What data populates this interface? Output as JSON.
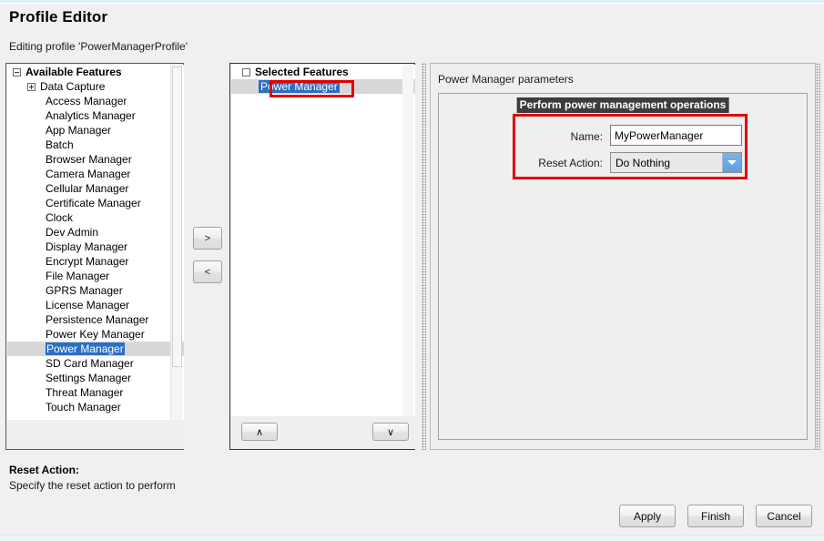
{
  "window": {
    "title": "Profile Editor",
    "subtitle": "Editing profile 'PowerManagerProfile'"
  },
  "available_panel": {
    "root_label": "Available Features",
    "items": [
      {
        "label": "Data Capture",
        "level": 1,
        "expander": "plus",
        "selected": false
      },
      {
        "label": "Access Manager",
        "level": 2,
        "expander": "none",
        "selected": false
      },
      {
        "label": "Analytics Manager",
        "level": 2,
        "expander": "none",
        "selected": false
      },
      {
        "label": "App Manager",
        "level": 2,
        "expander": "none",
        "selected": false
      },
      {
        "label": "Batch",
        "level": 2,
        "expander": "none",
        "selected": false
      },
      {
        "label": "Browser Manager",
        "level": 2,
        "expander": "none",
        "selected": false
      },
      {
        "label": "Camera Manager",
        "level": 2,
        "expander": "none",
        "selected": false
      },
      {
        "label": "Cellular Manager",
        "level": 2,
        "expander": "none",
        "selected": false
      },
      {
        "label": "Certificate Manager",
        "level": 2,
        "expander": "none",
        "selected": false
      },
      {
        "label": "Clock",
        "level": 2,
        "expander": "none",
        "selected": false
      },
      {
        "label": "Dev Admin",
        "level": 2,
        "expander": "none",
        "selected": false
      },
      {
        "label": "Display Manager",
        "level": 2,
        "expander": "none",
        "selected": false
      },
      {
        "label": "Encrypt Manager",
        "level": 2,
        "expander": "none",
        "selected": false
      },
      {
        "label": "File Manager",
        "level": 2,
        "expander": "none",
        "selected": false
      },
      {
        "label": "GPRS Manager",
        "level": 2,
        "expander": "none",
        "selected": false
      },
      {
        "label": "License Manager",
        "level": 2,
        "expander": "none",
        "selected": false
      },
      {
        "label": "Persistence Manager",
        "level": 2,
        "expander": "none",
        "selected": false
      },
      {
        "label": "Power Key Manager",
        "level": 2,
        "expander": "none",
        "selected": false
      },
      {
        "label": "Power Manager",
        "level": 2,
        "expander": "none",
        "selected": true
      },
      {
        "label": "SD Card Manager",
        "level": 2,
        "expander": "none",
        "selected": false
      },
      {
        "label": "Settings Manager",
        "level": 2,
        "expander": "none",
        "selected": false
      },
      {
        "label": "Threat Manager",
        "level": 2,
        "expander": "none",
        "selected": false
      },
      {
        "label": "Touch Manager",
        "level": 2,
        "expander": "none",
        "selected": false
      }
    ]
  },
  "transfer": {
    "add_label": ">",
    "remove_label": "<"
  },
  "selected_panel": {
    "root_label": "Selected Features",
    "items": [
      {
        "label": "Power Manager",
        "selected": true,
        "annotated": true
      }
    ],
    "move_up_label": "∧",
    "move_down_label": "∨"
  },
  "parameters": {
    "title": "Power Manager parameters",
    "group_title": "Perform power management operations",
    "fields": [
      {
        "label": "Name:",
        "type": "text",
        "value": "MyPowerManager"
      },
      {
        "label": "Reset Action:",
        "type": "combo",
        "value": "Do Nothing"
      }
    ]
  },
  "help": {
    "title": "Reset Action:",
    "body": "Specify the reset action to perform"
  },
  "buttons": {
    "apply": "Apply",
    "finish": "Finish",
    "cancel": "Cancel"
  },
  "colors": {
    "selection_blue": "#2b6fc4",
    "annotation_red": "#e00000",
    "group_header_bg": "#3d3d3d",
    "combo_arrow_blue": "#5d9fdd"
  }
}
